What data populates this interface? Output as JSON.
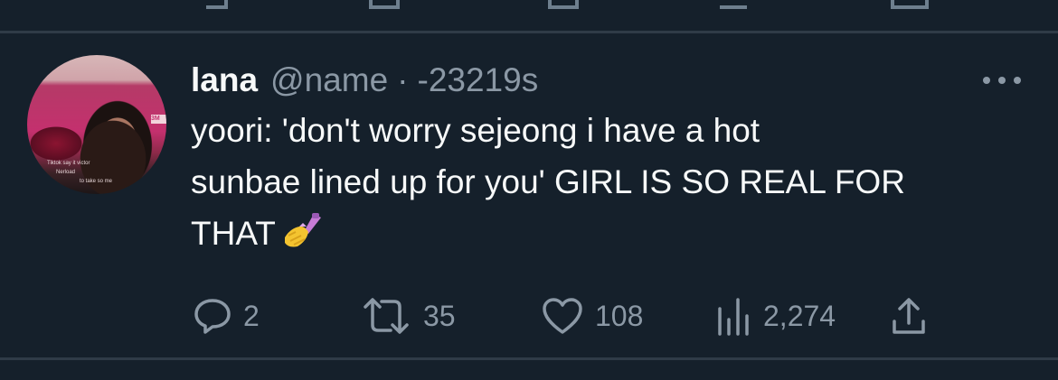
{
  "tweet": {
    "display_name": "lana",
    "handle": "@name",
    "separator": "·",
    "time": "-23219s",
    "text_line1": "yoori: 'don't worry sejeong i have a hot",
    "text_line2": "sunbae lined up for you' GIRL IS SO REAL FOR",
    "text_line3": "THAT",
    "emoji": "nail-polish-emoji",
    "avatar_caption_1": "Tiktok say it victor",
    "avatar_caption_2": "Nerload",
    "avatar_caption_3": "to take so me",
    "avatar_sign": "3M"
  },
  "actions": {
    "replies": "2",
    "retweets": "35",
    "likes": "108",
    "views": "2,274"
  },
  "colors": {
    "background": "#15202b",
    "text": "#f7f9f9",
    "secondary": "#8b98a5",
    "divider": "#2f3b47"
  }
}
